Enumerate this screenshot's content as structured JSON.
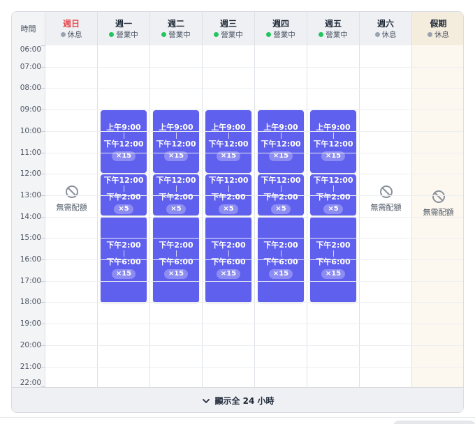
{
  "header": {
    "time_label": "時間",
    "days": [
      {
        "name": "週日",
        "status": "休息",
        "status_color": "#9aa3b2",
        "weekend": true
      },
      {
        "name": "週一",
        "status": "營業中",
        "status_color": "#22c55e"
      },
      {
        "name": "週二",
        "status": "營業中",
        "status_color": "#22c55e"
      },
      {
        "name": "週三",
        "status": "營業中",
        "status_color": "#22c55e"
      },
      {
        "name": "週四",
        "status": "營業中",
        "status_color": "#22c55e"
      },
      {
        "name": "週五",
        "status": "營業中",
        "status_color": "#22c55e"
      },
      {
        "name": "週六",
        "status": "休息",
        "status_color": "#9aa3b2"
      },
      {
        "name": "假期",
        "status": "休息",
        "status_color": "#9aa3b2",
        "holiday": true
      }
    ]
  },
  "hours": [
    "06:00",
    "07:00",
    "08:00",
    "09:00",
    "10:00",
    "11:00",
    "12:00",
    "13:00",
    "14:00",
    "15:00",
    "16:00",
    "17:00",
    "18:00",
    "19:00",
    "20:00",
    "21:00",
    "22:00"
  ],
  "slots": [
    {
      "start": "上午9:00",
      "end": "下午12:00",
      "capacity": "×15"
    },
    {
      "start": "下午12:00",
      "end": "下午2:00",
      "capacity": "×5"
    },
    {
      "start": "下午2:00",
      "end": "下午6:00",
      "capacity": "×15"
    }
  ],
  "no_quota_label": "無需配額",
  "footer": {
    "label": "顯示全 24 小時"
  },
  "colors": {
    "slot": "#6060ee",
    "sunday": "#e5484d",
    "holiday_bg": "#fdf8ef"
  }
}
